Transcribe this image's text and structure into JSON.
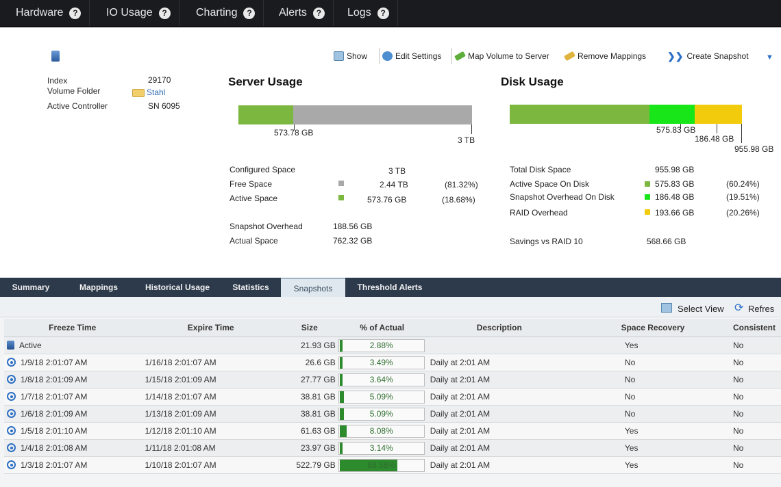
{
  "nav": {
    "items": [
      "Hardware",
      "IO Usage",
      "Charting",
      "Alerts",
      "Logs"
    ],
    "help_glyph": "?"
  },
  "toolbar": {
    "show": "Show",
    "edit_settings": "Edit Settings",
    "map_volume": "Map Volume to Server",
    "remove_mappings": "Remove Mappings",
    "create_snapshot": "Create Snapshot"
  },
  "volume": {
    "index_label": "Index",
    "index_value": "29170",
    "folder_label": "Volume Folder",
    "folder_value": "Stahl",
    "controller_label": "Active Controller",
    "controller_value": "SN 6095"
  },
  "server_usage": {
    "title": "Server Usage",
    "bar_used_label": "573.78 GB",
    "bar_total_label": "3 TB",
    "used_fraction": 0.2353,
    "configured_label": "Configured Space",
    "configured_value": "3 TB",
    "free_label": "Free Space",
    "free_value": "2.44 TB",
    "free_pct": "(81.32%)",
    "active_label": "Active Space",
    "active_value": "573.76 GB",
    "active_pct": "(18.68%)",
    "snapshot_overhead_label": "Snapshot Overhead",
    "snapshot_overhead_value": "188.56 GB",
    "actual_label": "Actual Space",
    "actual_value": "762.32 GB",
    "colors": {
      "used": "#7cb83f",
      "free": "#a9a9a9"
    }
  },
  "disk_usage": {
    "title": "Disk Usage",
    "bar_active_label": "575.83 GB",
    "bar_snapshot_label": "186.48 GB",
    "bar_total_label": "955.98 GB",
    "segments": [
      0.6024,
      0.1951,
      0.2026
    ],
    "total_label": "Total Disk Space",
    "total_value": "955.98 GB",
    "active_label": "Active Space On Disk",
    "active_value": "575.83 GB",
    "active_pct": "(60.24%)",
    "snapshot_label": "Snapshot Overhead On Disk",
    "snapshot_value": "186.48 GB",
    "snapshot_pct": "(19.51%)",
    "raid_label": "RAID Overhead",
    "raid_value": "193.66 GB",
    "raid_pct": "(20.26%)",
    "savings_label": "Savings vs RAID 10",
    "savings_value": "568.66 GB",
    "colors": {
      "active": "#7cb83f",
      "snapshot": "#19e619",
      "raid": "#f2cc0c"
    }
  },
  "tabs": [
    "Summary",
    "Mappings",
    "Historical Usage",
    "Statistics",
    "Snapshots",
    "Threshold Alerts"
  ],
  "active_tab": "Snapshots",
  "grid_toolbar": {
    "select_view": "Select View",
    "refresh": "Refres"
  },
  "table": {
    "columns": [
      "Freeze Time",
      "Expire Time",
      "Size",
      "% of Actual",
      "Description",
      "Space Recovery",
      "Consistent"
    ],
    "rows": [
      {
        "freeze": "Active",
        "expire": "",
        "size": "21.93 GB",
        "pct": "2.88%",
        "pct_value": 2.88,
        "desc": "",
        "recovery": "Yes",
        "consistent": "No",
        "active": true
      },
      {
        "freeze": "1/9/18  2:01:07 AM",
        "expire": "1/16/18  2:01:07 AM",
        "size": "26.6 GB",
        "pct": "3.49%",
        "pct_value": 3.49,
        "desc": "Daily at  2:01 AM",
        "recovery": "No",
        "consistent": "No"
      },
      {
        "freeze": "1/8/18  2:01:09 AM",
        "expire": "1/15/18  2:01:09 AM",
        "size": "27.77 GB",
        "pct": "3.64%",
        "pct_value": 3.64,
        "desc": "Daily at  2:01 AM",
        "recovery": "No",
        "consistent": "No"
      },
      {
        "freeze": "1/7/18  2:01:07 AM",
        "expire": "1/14/18  2:01:07 AM",
        "size": "38.81 GB",
        "pct": "5.09%",
        "pct_value": 5.09,
        "desc": "Daily at  2:01 AM",
        "recovery": "No",
        "consistent": "No"
      },
      {
        "freeze": "1/6/18  2:01:09 AM",
        "expire": "1/13/18  2:01:09 AM",
        "size": "38.81 GB",
        "pct": "5.09%",
        "pct_value": 5.09,
        "desc": "Daily at  2:01 AM",
        "recovery": "No",
        "consistent": "No"
      },
      {
        "freeze": "1/5/18  2:01:10 AM",
        "expire": "1/12/18  2:01:10 AM",
        "size": "61.63 GB",
        "pct": "8.08%",
        "pct_value": 8.08,
        "desc": "Daily at  2:01 AM",
        "recovery": "Yes",
        "consistent": "No"
      },
      {
        "freeze": "1/4/18  2:01:08 AM",
        "expire": "1/11/18  2:01:08 AM",
        "size": "23.97 GB",
        "pct": "3.14%",
        "pct_value": 3.14,
        "desc": "Daily at  2:01 AM",
        "recovery": "Yes",
        "consistent": "No"
      },
      {
        "freeze": "1/3/18  2:01:07 AM",
        "expire": "1/10/18  2:01:07 AM",
        "size": "522.79 GB",
        "pct": "68.58%",
        "pct_value": 68.58,
        "desc": "Daily at  2:01 AM",
        "recovery": "Yes",
        "consistent": "No"
      }
    ]
  }
}
